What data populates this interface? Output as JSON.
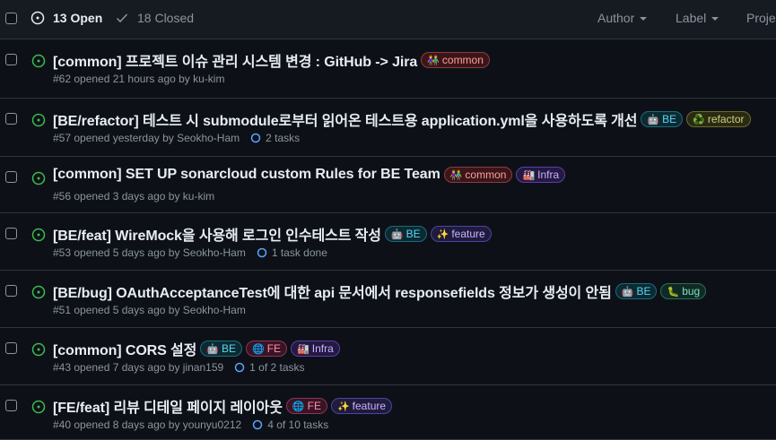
{
  "header": {
    "open_label": "13 Open",
    "closed_label": "18 Closed",
    "filters": [
      "Author",
      "Label",
      "Proje"
    ]
  },
  "issues": [
    {
      "title": "[common] 프로젝트 이슈 관리 시스템 변경 : GitHub -> Jira",
      "labels": [
        {
          "emoji": "👫",
          "name": "common",
          "cls": "lbl-common"
        }
      ],
      "meta": "#62 opened 21 hours ago by ku-kim",
      "task": ""
    },
    {
      "title": "[BE/refactor] 테스트 시 submodule로부터 읽어온 테스트용 application.yml을 사용하도록 개선",
      "labels": [
        {
          "emoji": "🤖",
          "name": "BE",
          "cls": "lbl-be"
        },
        {
          "emoji": "♻️",
          "name": "refactor",
          "cls": "lbl-refactor"
        }
      ],
      "meta": "#57 opened yesterday by Seokho-Ham",
      "task": "2 tasks"
    },
    {
      "title": "[common] SET UP sonarcloud custom Rules for BE Team",
      "labels": [
        {
          "emoji": "👫",
          "name": "common",
          "cls": "lbl-common"
        },
        {
          "emoji": "🏭",
          "name": "Infra",
          "cls": "lbl-infra"
        }
      ],
      "meta": "#56 opened 3 days ago by ku-kim",
      "task": ""
    },
    {
      "title": "[BE/feat] WireMock을 사용해 로그인 인수테스트 작성",
      "labels": [
        {
          "emoji": "🤖",
          "name": "BE",
          "cls": "lbl-be"
        },
        {
          "emoji": "✨",
          "name": "feature",
          "cls": "lbl-feature"
        }
      ],
      "meta": "#53 opened 5 days ago by Seokho-Ham",
      "task": "1 task done"
    },
    {
      "title": "[BE/bug] OAuthAcceptanceTest에 대한 api 문서에서 responsefields 정보가 생성이 안됨",
      "labels": [
        {
          "emoji": "🤖",
          "name": "BE",
          "cls": "lbl-be"
        },
        {
          "emoji": "🐛",
          "name": "bug",
          "cls": "lbl-bug"
        }
      ],
      "meta": "#51 opened 5 days ago by Seokho-Ham",
      "task": ""
    },
    {
      "title": "[common] CORS 설정",
      "labels": [
        {
          "emoji": "🤖",
          "name": "BE",
          "cls": "lbl-be"
        },
        {
          "emoji": "🌐",
          "name": "FE",
          "cls": "lbl-fe"
        },
        {
          "emoji": "🏭",
          "name": "Infra",
          "cls": "lbl-infra"
        }
      ],
      "meta": "#43 opened 7 days ago by jinan159",
      "task": "1 of 2 tasks"
    },
    {
      "title": "[FE/feat] 리뷰 디테일 페이지 레이아웃",
      "labels": [
        {
          "emoji": "🌐",
          "name": "FE",
          "cls": "lbl-fe"
        },
        {
          "emoji": "✨",
          "name": "feature",
          "cls": "lbl-feature"
        }
      ],
      "meta": "#40 opened 8 days ago by younyu0212",
      "task": "4 of 10 tasks"
    }
  ],
  "colors": {
    "open": "#3fb950",
    "background": "#0d1117",
    "border": "#30363d",
    "muted": "#8b949e"
  }
}
